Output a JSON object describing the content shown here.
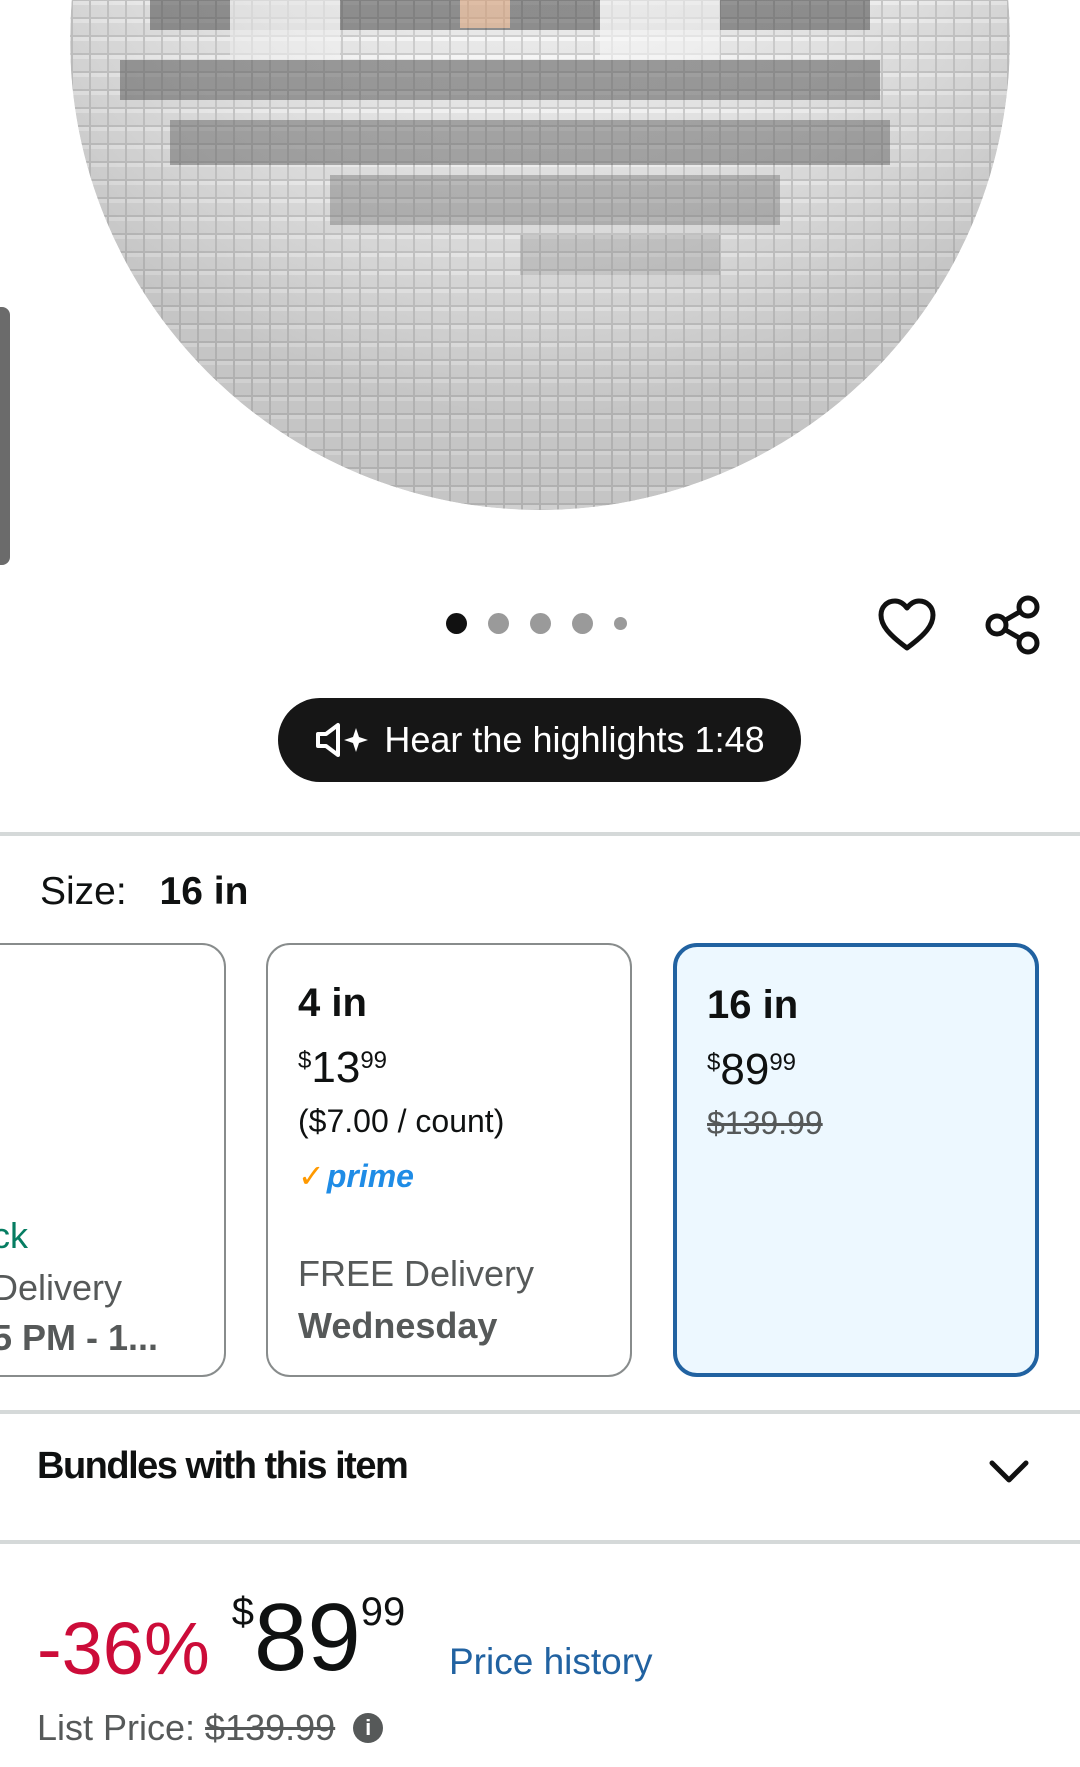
{
  "gallery": {
    "image_name": "mirror-disco-ball",
    "dots_count": 5,
    "active_dot": 0
  },
  "actions": {
    "wishlist_icon": "heart-icon",
    "share_icon": "share-icon"
  },
  "audio": {
    "label": "Hear the highlights 1:48",
    "icon": "speaker-sparkle-icon"
  },
  "size": {
    "label": "Size:",
    "selected": "16 in"
  },
  "options": {
    "partial": {
      "stock": "ck",
      "delivery": "Delivery",
      "time": "5 PM - 1..."
    },
    "four": {
      "title": "4 in",
      "price_currency": "$",
      "price_whole": "13",
      "price_cents": "99",
      "unit_price": "($7.00 / count)",
      "prime": "prime",
      "delivery": "FREE Delivery",
      "day": "Wednesday"
    },
    "sixteen": {
      "title": "16 in",
      "price_currency": "$",
      "price_whole": "89",
      "price_cents": "99",
      "list_price": "$139.99"
    }
  },
  "bundles": {
    "label": "Bundles with this item"
  },
  "pricing": {
    "discount": "-36%",
    "currency": "$",
    "whole": "89",
    "cents": "99",
    "history_link": "Price history",
    "list_label": "List Price:",
    "list_value": "$139.99",
    "info_glyph": "i"
  },
  "colors": {
    "accent_blue": "#2162a1",
    "discount_red": "#cc0c39",
    "prime_blue": "#1f8ce6",
    "stock_green": "#067d62"
  }
}
